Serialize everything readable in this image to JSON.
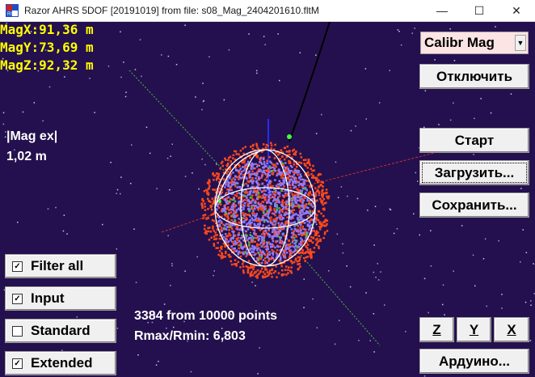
{
  "window": {
    "title": "Razor AHRS 5DOF [20191019]  from file:  s08_Mag_2404201610.fltM",
    "minimize": "—",
    "maximize": "☐",
    "close": "✕"
  },
  "readouts": {
    "mag_x": "MagX:91,36 m",
    "mag_y": "MagY:73,69 m",
    "mag_z": "MagZ:92,32 m"
  },
  "mag_ex": {
    "label": "|Mag ex|",
    "value": "1,02 m"
  },
  "status": {
    "points": "3384 from 10000 points",
    "ratio": "Rmax/Rmin: 6,803"
  },
  "buttons": {
    "calibr_mag": "Calibr Mag",
    "disconnect": "Отключить",
    "start": "Старт",
    "load": "Загрузить...",
    "save": "Сохранить...",
    "axis_z": "Z",
    "axis_y": "Y",
    "axis_x": "X",
    "arduino": "Ардуино..."
  },
  "checkboxes": [
    {
      "label": "Filter all",
      "checked": true,
      "mark": "✓"
    },
    {
      "label": "Input",
      "checked": true,
      "mark": "✓"
    },
    {
      "label": "Standard",
      "checked": false,
      "mark": ""
    },
    {
      "label": "Extended",
      "checked": true,
      "mark": "✓"
    }
  ],
  "colors": {
    "background": "#24104e",
    "readout": "#ffff00",
    "input_points": "#ff4a1a",
    "filtered_points": "#8c7cff",
    "sphere_wire": "#ffffff",
    "axis_red": "#cc3030"
  }
}
